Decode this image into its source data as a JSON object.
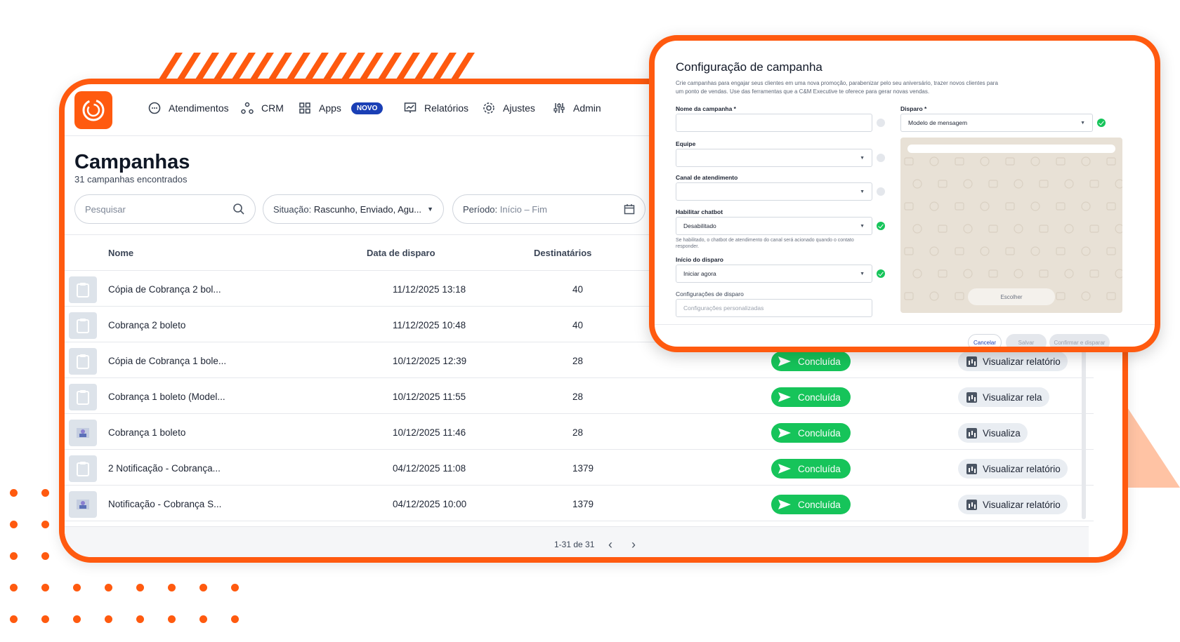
{
  "colors": {
    "brand_orange": "#ff5a0f",
    "status_green": "#16c45a",
    "badge_blue": "#1a3fb5"
  },
  "nav": {
    "items": [
      {
        "label": "Atendimentos",
        "icon": "chat-icon"
      },
      {
        "label": "CRM",
        "icon": "network-icon"
      },
      {
        "label": "Apps",
        "icon": "grid-icon",
        "badge": "NOVO"
      },
      {
        "label": "Relatórios",
        "icon": "chart-icon"
      },
      {
        "label": "Ajustes",
        "icon": "gear-icon"
      },
      {
        "label": "Admin",
        "icon": "sliders-icon"
      }
    ]
  },
  "page": {
    "title": "Campanhas",
    "subtitle": "31 campanhas encontrados"
  },
  "filters": {
    "search_placeholder": "Pesquisar",
    "situacao_label": "Situação:",
    "situacao_value": "Rascunho, Enviado, Agu...",
    "periodo_label": "Período:",
    "periodo_value": "Início – Fim"
  },
  "table": {
    "columns": [
      "Nome",
      "Data de disparo",
      "Destinatários"
    ],
    "rows": [
      {
        "name": "Cópia de Cobrança 2 bol...",
        "date": "11/12/2025 13:18",
        "recipients": "40",
        "status": "",
        "report": "",
        "thumb": "clipboard-icon"
      },
      {
        "name": "Cobrança 2 boleto",
        "date": "11/12/2025 10:48",
        "recipients": "40",
        "status": "",
        "report": "",
        "thumb": "clipboard-icon"
      },
      {
        "name": "Cópia de Cobrança 1 bole...",
        "date": "10/12/2025 12:39",
        "recipients": "28",
        "status": "Concluída",
        "report": "Visualizar relatório",
        "thumb": "clipboard-icon"
      },
      {
        "name": "Cobrança 1 boleto (Model...",
        "date": "10/12/2025 11:55",
        "recipients": "28",
        "status": "Concluída",
        "report": "Visualizar rela",
        "thumb": "clipboard-icon"
      },
      {
        "name": "Cobrança 1 boleto",
        "date": "10/12/2025 11:46",
        "recipients": "28",
        "status": "Concluída",
        "report": "Visualiza",
        "thumb": "image-thumbnail-icon"
      },
      {
        "name": "2 Notificação - Cobrança...",
        "date": "04/12/2025 11:08",
        "recipients": "1379",
        "status": "Concluída",
        "report": "Visualizar relatório",
        "thumb": "clipboard-icon"
      },
      {
        "name": "Notificação - Cobrança S...",
        "date": "04/12/2025 10:00",
        "recipients": "1379",
        "status": "Concluída",
        "report": "Visualizar relatório",
        "thumb": "image-thumbnail-icon"
      }
    ]
  },
  "pagination": {
    "text": "1-31 de 31"
  },
  "modal": {
    "title": "Configuração de campanha",
    "description": "Crie campanhas para engajar seus clientes em uma nova promoção, parabenizar pelo seu aniversário, trazer novos clientes para um ponto de vendas. Use das ferramentas que a C&M Executive te oferece para gerar novas vendas.",
    "fields": {
      "nome_label": "Nome da campanha *",
      "nome_value": "",
      "equipe_label": "Equipe",
      "equipe_value": "",
      "canal_label": "Canal de atendimento",
      "canal_value": "",
      "chatbot_label": "Habilitar chatbot",
      "chatbot_value": "Desabilitado",
      "chatbot_hint": "Se habilitado, o chatbot de atendimento do canal será acionado quando o contato responder.",
      "inicio_label": "Início do disparo",
      "inicio_value": "Iniciar agora",
      "config_label": "Configurações de disparo",
      "config_placeholder": "Configurações personalizadas",
      "disparo_label": "Disparo *",
      "disparo_value": "Modelo de mensagem"
    },
    "preview_button": "Escolher",
    "buttons": {
      "cancel": "Cancelar",
      "save": "Salvar",
      "confirm": "Confirmar e disparar"
    }
  }
}
